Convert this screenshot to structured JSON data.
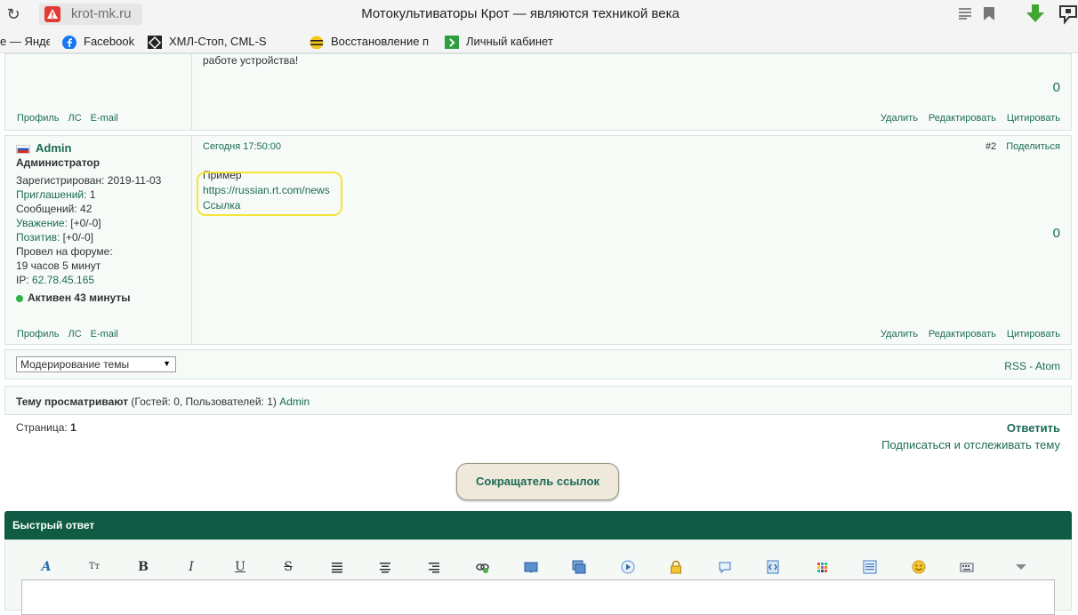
{
  "browser": {
    "url": "krot-mk.ru",
    "page_title": "Мотокультиваторы Крот — являются техникой века",
    "bookmarks": [
      {
        "label": "е — Янде",
        "icon": "yandex-icon"
      },
      {
        "label": "Facebook",
        "icon": "facebook-icon"
      },
      {
        "label": "ХМЛ-Стоп, CML-S",
        "icon": "xml-stop-icon"
      },
      {
        "label": "Восстановление п",
        "icon": "beeline-icon"
      },
      {
        "label": "Личный кабинет",
        "icon": "cabinet-icon"
      }
    ]
  },
  "prev_post": {
    "text_tail": "работе устройства!",
    "score": "0",
    "author_links": [
      "Профиль",
      "ЛС",
      "E-mail"
    ],
    "actions": [
      "Удалить",
      "Редактировать",
      "Цитировать"
    ]
  },
  "post": {
    "user": {
      "name": "Admin",
      "role": "Администратор",
      "registered_label": "Зарегистрирован:",
      "registered": "2019-11-03",
      "invites_label": "Приглашений:",
      "invites": "1",
      "messages_label": "Сообщений:",
      "messages": "42",
      "respect_label": "Уважение:",
      "respect": "[+0/-0]",
      "positive_label": "Позитив:",
      "positive": "[+0/-0]",
      "time_label": "Провел на форуме:",
      "time": "19 часов 5 минут",
      "ip_label": "IP:",
      "ip": "62.78.45.165",
      "status": "Активен 43 минуты"
    },
    "timestamp": "Сегодня 17:50:00",
    "number": "#2",
    "share": "Поделиться",
    "body_text": "Пример",
    "link_url": "https://russian.rt.com/news",
    "link_text": "Ссылка",
    "score": "0",
    "author_links": [
      "Профиль",
      "ЛС",
      "E-mail"
    ],
    "actions": [
      "Удалить",
      "Редактировать",
      "Цитировать"
    ]
  },
  "moderation": {
    "select_value": "Модерирование темы",
    "rss": "RSS",
    "separator": " - ",
    "atom": "Atom"
  },
  "viewers": {
    "label": "Тему просматривают",
    "details": " (Гостей: 0, Пользователей: 1) ",
    "user": "Admin"
  },
  "pagination": {
    "label": "Страница:",
    "page": "1"
  },
  "reply_link": "Ответить",
  "subscribe_link": "Подписаться и отслеживать тему",
  "shortener_button": "Сокращатель ссылок",
  "quick_reply": {
    "title": "Быстрый ответ",
    "toolbar": [
      "font-icon",
      "text-size-icon",
      "bold-icon",
      "italic-icon",
      "underline-icon",
      "strike-icon",
      "align-left-icon",
      "align-center-icon",
      "align-right-icon",
      "link-icon",
      "book-icon",
      "image-icon",
      "video-icon",
      "lock-icon",
      "quote-icon",
      "code-icon",
      "table-icon",
      "smile-icon",
      "keyboard-icon",
      "more-icon"
    ]
  },
  "colors": {
    "accent": "#1b6b55",
    "header_green": "#0f5b44",
    "highlight": "#f3e53a"
  }
}
